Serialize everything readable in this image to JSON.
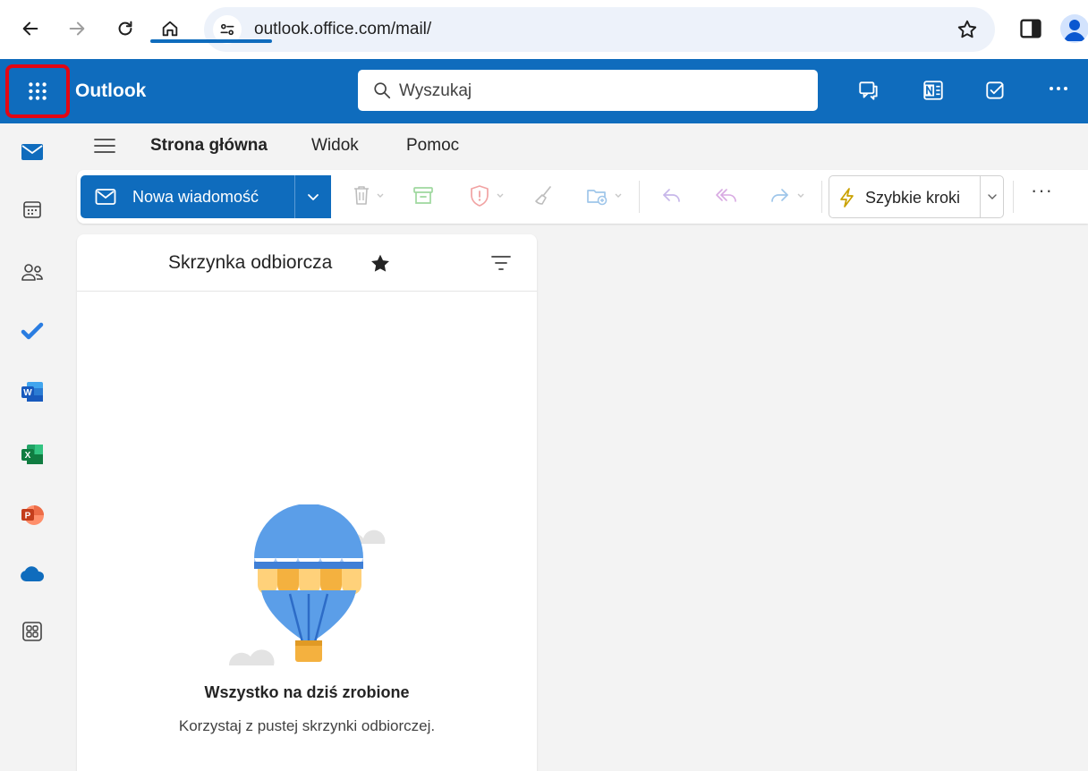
{
  "browser": {
    "url": "outlook.office.com/mail/"
  },
  "header": {
    "brand": "Outlook",
    "search_placeholder": "Wyszukaj",
    "icons": [
      "chat-icon",
      "onenote-icon",
      "todo-check-icon",
      "more-icon"
    ]
  },
  "tabs": [
    {
      "label": "Strona główna",
      "active": true
    },
    {
      "label": "Widok",
      "active": false
    },
    {
      "label": "Pomoc",
      "active": false
    }
  ],
  "toolbar": {
    "new_message": "Nowa wiadomość",
    "quick_steps": "Szybkie kroki",
    "more": "···"
  },
  "rail": [
    "mail-icon",
    "calendar-icon",
    "people-icon",
    "todo-icon",
    "word-icon",
    "excel-icon",
    "powerpoint-icon",
    "onedrive-icon",
    "apps-icon"
  ],
  "list": {
    "folder_title": "Skrzynka odbiorcza",
    "empty_title": "Wszystko na dziś zrobione",
    "empty_subtitle": "Korzystaj z pustej skrzynki odbiorczej."
  },
  "colors": {
    "brand": "#0f6cbd",
    "highlight_border": "#e30613"
  }
}
